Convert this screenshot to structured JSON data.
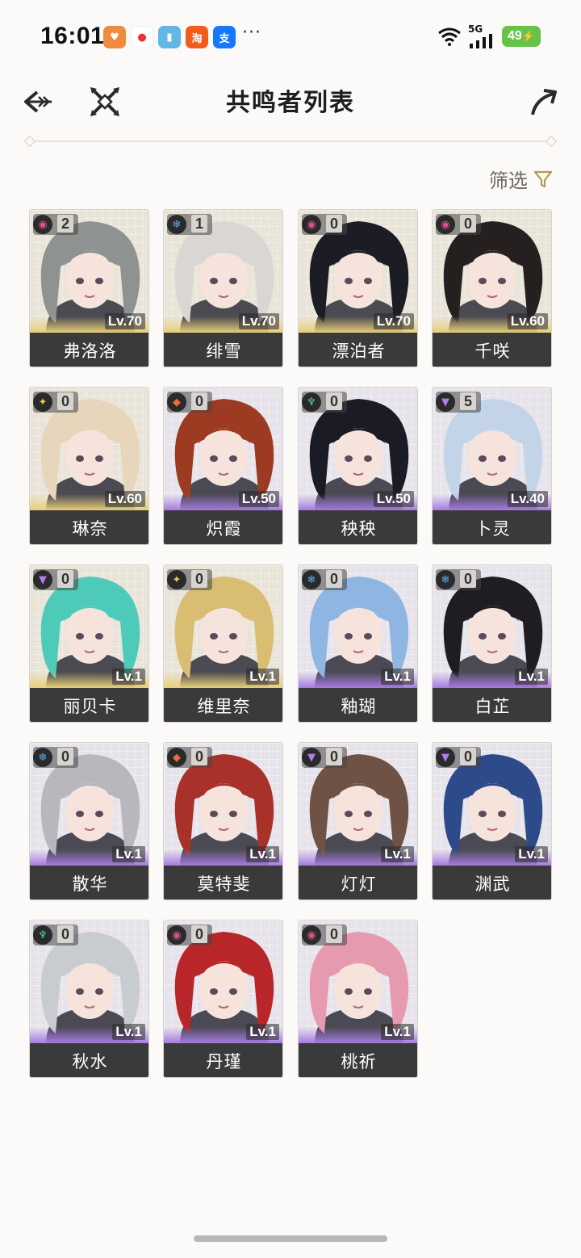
{
  "status": {
    "time": "16:01",
    "more": "···",
    "network": "5G",
    "battery": "49"
  },
  "header": {
    "title": "共鸣者列表"
  },
  "filter": {
    "label": "筛选"
  },
  "colors": {
    "accent": "#b39a4c",
    "name_bar": "#3a3a3a",
    "gold": "#e8cf7a",
    "purple": "#a67be0"
  },
  "characters": [
    {
      "name": "弗洛洛",
      "level": "Lv.70",
      "const": "2",
      "element": "havoc",
      "rarity": "gold",
      "hair": "#8e9291"
    },
    {
      "name": "绯雪",
      "level": "Lv.70",
      "const": "1",
      "element": "glacio",
      "rarity": "gold",
      "hair": "#d9d6d4"
    },
    {
      "name": "漂泊者",
      "level": "Lv.70",
      "const": "0",
      "element": "havoc",
      "rarity": "gold",
      "hair": "#1c1d24"
    },
    {
      "name": "千咲",
      "level": "Lv.60",
      "const": "0",
      "element": "havoc",
      "rarity": "gold",
      "hair": "#25201f"
    },
    {
      "name": "琳奈",
      "level": "Lv.60",
      "const": "0",
      "element": "spectro",
      "rarity": "gold",
      "hair": "#e8d6bc"
    },
    {
      "name": "炽霞",
      "level": "Lv.50",
      "const": "0",
      "element": "fusion",
      "rarity": "purple",
      "hair": "#9c3a22"
    },
    {
      "name": "秧秧",
      "level": "Lv.50",
      "const": "0",
      "element": "aero",
      "rarity": "purple",
      "hair": "#1a1b24"
    },
    {
      "name": "卜灵",
      "level": "Lv.40",
      "const": "5",
      "element": "electro",
      "rarity": "purple",
      "hair": "#c4d4e8"
    },
    {
      "name": "丽贝卡",
      "level": "Lv.1",
      "const": "0",
      "element": "electro",
      "rarity": "gold",
      "hair": "#4ecbb8"
    },
    {
      "name": "维里奈",
      "level": "Lv.1",
      "const": "0",
      "element": "spectro",
      "rarity": "gold",
      "hair": "#d9bd72"
    },
    {
      "name": "釉瑚",
      "level": "Lv.1",
      "const": "0",
      "element": "glacio",
      "rarity": "purple",
      "hair": "#8fb6e2"
    },
    {
      "name": "白芷",
      "level": "Lv.1",
      "const": "0",
      "element": "glacio",
      "rarity": "purple",
      "hair": "#1f1c22"
    },
    {
      "name": "散华",
      "level": "Lv.1",
      "const": "0",
      "element": "glacio",
      "rarity": "purple",
      "hair": "#b7b7bd"
    },
    {
      "name": "莫特斐",
      "level": "Lv.1",
      "const": "0",
      "element": "fusion",
      "rarity": "purple",
      "hair": "#a8322a"
    },
    {
      "name": "灯灯",
      "level": "Lv.1",
      "const": "0",
      "element": "electro",
      "rarity": "purple",
      "hair": "#6e5246"
    },
    {
      "name": "渊武",
      "level": "Lv.1",
      "const": "0",
      "element": "electro",
      "rarity": "purple",
      "hair": "#2d4a8a"
    },
    {
      "name": "秋水",
      "level": "Lv.1",
      "const": "0",
      "element": "aero",
      "rarity": "purple",
      "hair": "#c8cbd0"
    },
    {
      "name": "丹瑾",
      "level": "Lv.1",
      "const": "0",
      "element": "havoc",
      "rarity": "purple",
      "hair": "#b8262a"
    },
    {
      "name": "桃祈",
      "level": "Lv.1",
      "const": "0",
      "element": "havoc",
      "rarity": "purple",
      "hair": "#e59ab0"
    }
  ]
}
